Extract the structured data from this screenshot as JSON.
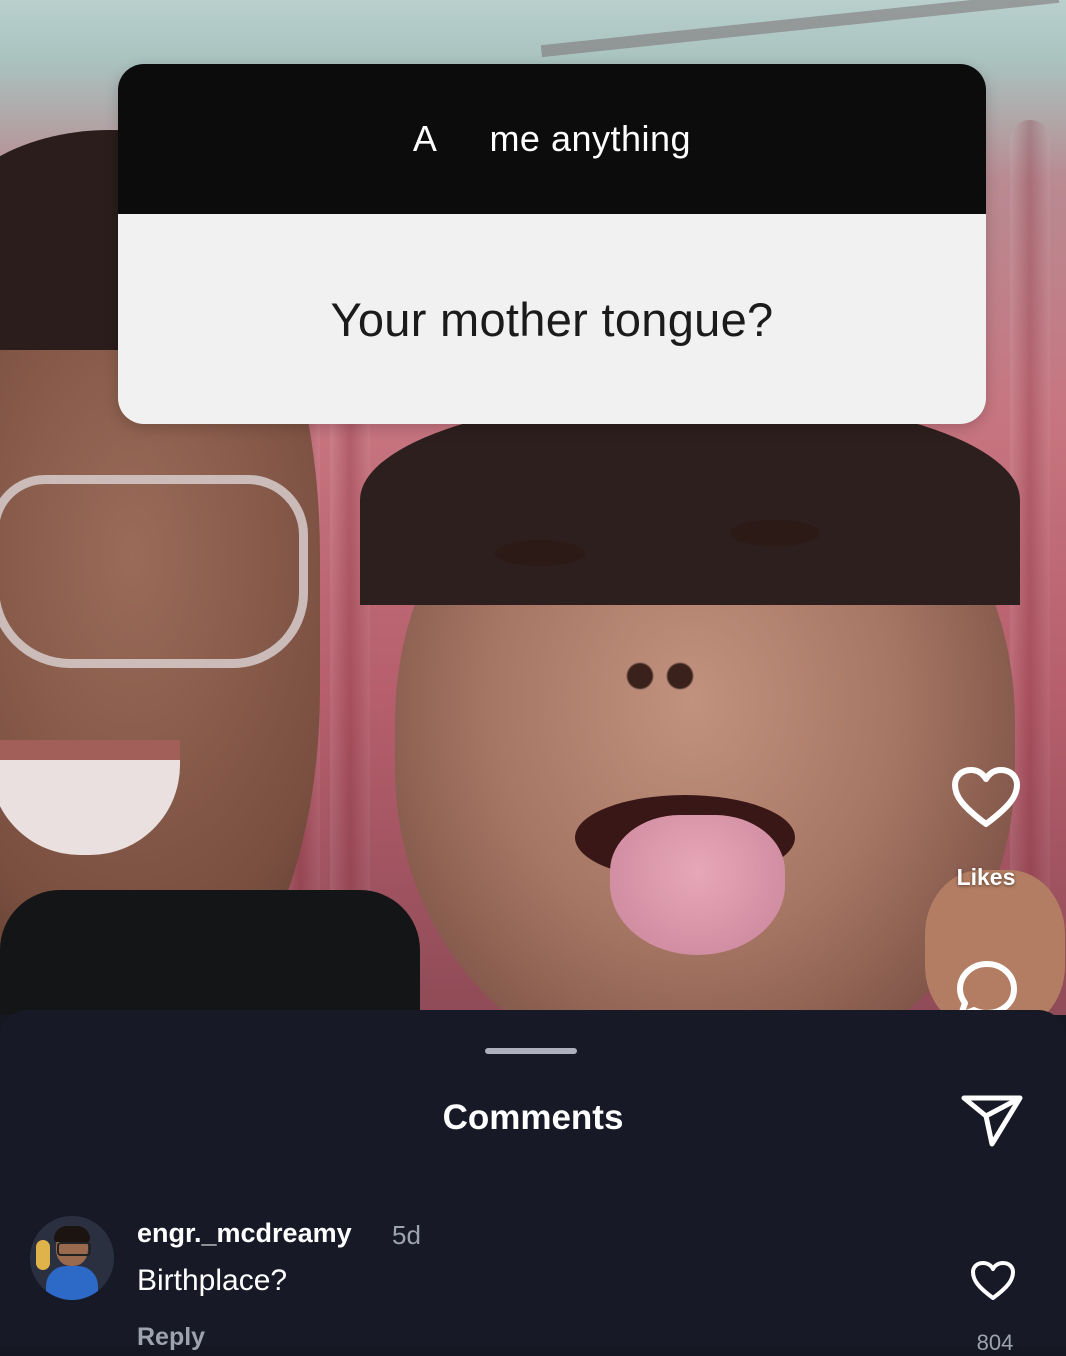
{
  "question_sticker": {
    "header_left": "A",
    "header_right": "me anything",
    "question": "Your mother tongue?"
  },
  "actions": {
    "like_icon": "heart-outline-icon",
    "likes_label": "Likes",
    "comment_icon": "comment-bubble-icon"
  },
  "comments_sheet": {
    "title": "Comments",
    "share_icon": "paper-plane-icon",
    "comments": [
      {
        "username": "engr._mcdreamy",
        "time": "5d",
        "text": "Birthplace?",
        "reply_label": "Reply",
        "like_count": "804"
      }
    ]
  },
  "colors": {
    "sheet_background": "#171926",
    "sticker_header": "#0c0c0c",
    "sticker_body": "#f1f1f1",
    "secondary_text": "#9ea2ae"
  }
}
